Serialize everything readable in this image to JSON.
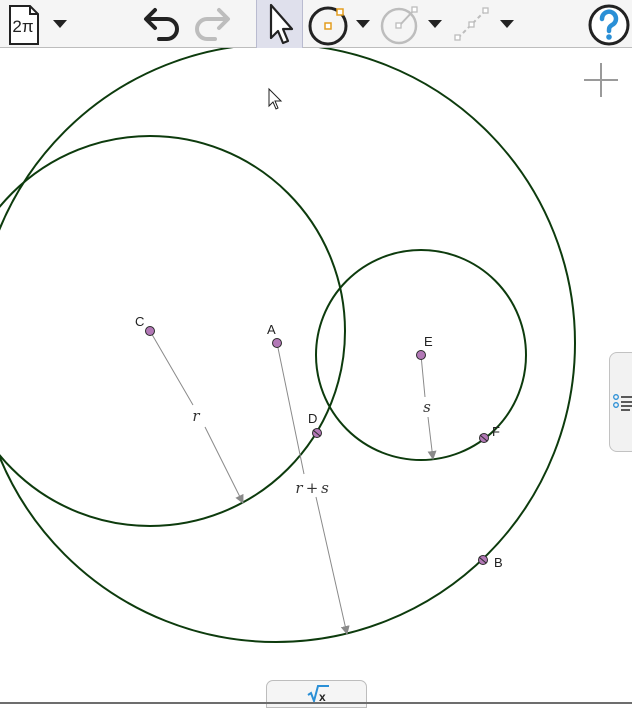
{
  "toolbar": {
    "file_icon_text": "2π",
    "icons": {
      "file": "document-2pi-icon",
      "undo": "undo-icon",
      "redo": "redo-icon",
      "move": "arrow-pointer-icon",
      "circle_tool": "circle-with-center-icon",
      "compass_tool": "compass-circle-icon",
      "segment_tool": "dashed-segment-icon",
      "help": "help-question-icon"
    }
  },
  "canvas": {
    "points": {
      "A": "A",
      "B": "B",
      "C": "C",
      "D": "D",
      "E": "E",
      "F": "F"
    },
    "radius_labels": {
      "r": "r",
      "s": "s",
      "sum_r": "r",
      "plus": "+",
      "sum_s": "s"
    },
    "colors": {
      "circle": "#0d3b0d",
      "point_fill": "#b278b6",
      "arrow": "#8a8a8a"
    }
  },
  "side_panel": {
    "icon": "list-menu-icon"
  },
  "keyboard": {
    "icon": "sqrt-x-keyboard-icon",
    "label": "√x"
  }
}
